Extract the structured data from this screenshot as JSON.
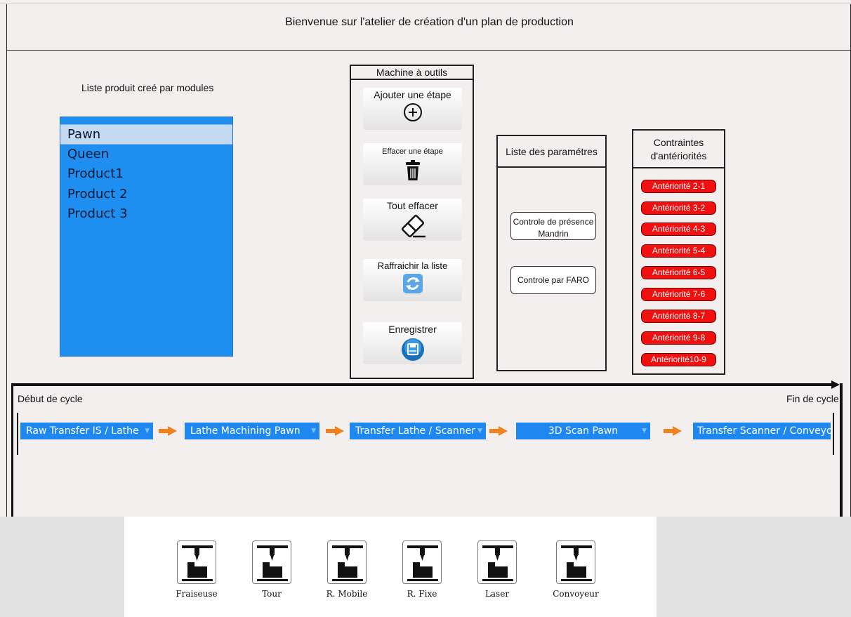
{
  "header": {
    "title": "Bienvenue sur l'atelier de création d'un plan de production"
  },
  "products": {
    "caption": "Liste produit creé par modules",
    "items": [
      "Pawn",
      "Queen",
      "Product1",
      "Product 2",
      "Product 3"
    ],
    "selected": "Pawn"
  },
  "machine_panel": {
    "title": "Machine à outils",
    "buttons": {
      "add": "Ajouter une étape",
      "delete": "Effacer une étape",
      "clear": "Tout effacer",
      "refresh": "Raffraichir la liste",
      "save": "Enregistrer"
    }
  },
  "params_panel": {
    "title": "Liste des paramétres",
    "buttons": [
      "Controle de présence Mandrin",
      "Controle par FARO"
    ]
  },
  "constraints_panel": {
    "title": "Contraintes d'antériorités",
    "items": [
      "Antériorité 2-1",
      "Antériorité 3-2",
      "Antériorité 4-3",
      "Antériorité 5-4",
      "Antériorité 6-5",
      "Antériorité 7-6",
      "Antériorité 8-7",
      "Antériorité 9-8",
      "Antériorité10-9"
    ]
  },
  "cycle": {
    "start_label": "Début de cycle",
    "end_label": "Fin de cycle",
    "steps": [
      "Raw Transfer IS / Lathe",
      "Lathe Machining Pawn",
      "Transfer Lathe / Scanner",
      "3D Scan Pawn",
      "Transfer Scanner / Conveyor"
    ]
  },
  "machines": [
    "Fraiseuse",
    "Tour",
    "R. Mobile",
    "R. Fixe",
    "Laser",
    "Convoyeur"
  ],
  "colors": {
    "list_blue": "#1e8ef0",
    "step_blue": "#1e88f0",
    "arrow_orange": "#f0821e",
    "constraint_red": "#f01010",
    "background": "#f3efef"
  }
}
